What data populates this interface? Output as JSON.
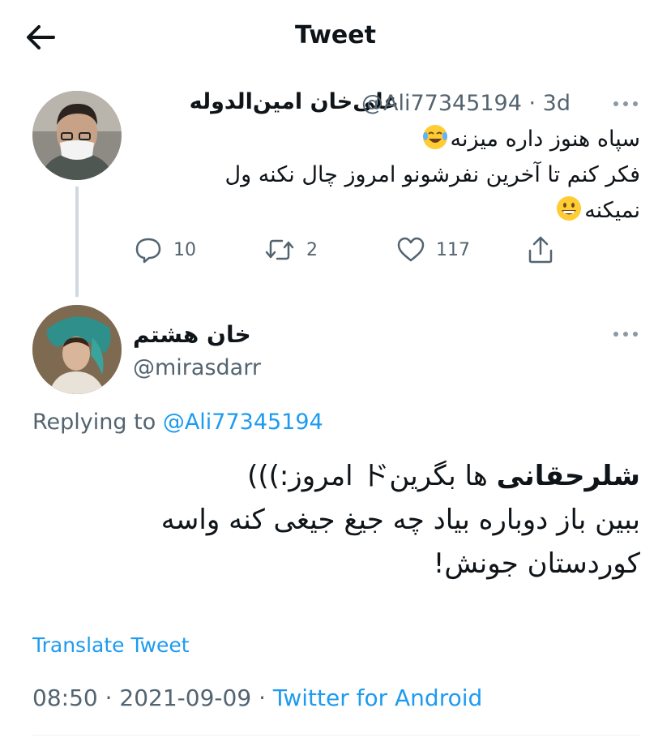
{
  "header": {
    "title": "Tweet",
    "back_icon": "back-arrow-icon"
  },
  "parent_tweet": {
    "display_name": "علی‌خان امین‌الدوله",
    "handle": "@Ali77345194",
    "separator": "·",
    "age": "3d",
    "text_lines": [
      "سپاه هنوز داره میزنه",
      "فکر کنم تا آخرین نفرشونو امروز چال نکنه ول",
      "نمیکنه"
    ],
    "emojis": [
      "face-with-tears-of-joy-emoji",
      "grinning-face-emoji"
    ],
    "actions": {
      "replies": "10",
      "retweets": "2",
      "likes": "117"
    }
  },
  "reply_tweet": {
    "display_name": "خان هشتم",
    "handle": "@mirasdarr",
    "replying_prefix": "Replying to",
    "replying_to": "@Ali77345194",
    "text_bold": "شلرحقانی",
    "text_line1_rest": " ها بگرینド امروز:)))",
    "text_line2": "ببین باز دوباره بیاد چه جیغ جیغی کنه واسه",
    "text_line3": "کوردستان جونش!",
    "translate_label": "Translate Tweet",
    "time": "08:50",
    "separator": "·",
    "date": "2021-09-09",
    "source": "Twitter for Android"
  },
  "colors": {
    "accent": "#1d9bf0",
    "text": "#0f1419",
    "secondary": "#536471",
    "thread_line": "#cfd9de"
  }
}
